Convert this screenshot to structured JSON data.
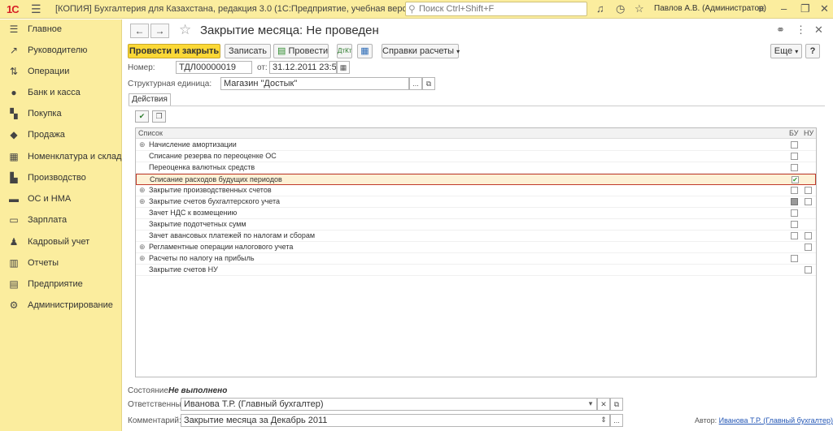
{
  "topbar": {
    "logo": "1С",
    "title": "[КОПИЯ] Бухгалтерия для Казахстана, редакция 3.0  (1С:Предприятие, учебная версия)",
    "search_placeholder": "Поиск Ctrl+Shift+F",
    "user": "Павлов А.В. (Администратор)"
  },
  "sidebar": {
    "items": [
      {
        "icon": "menu-icon",
        "glyph": "☰",
        "label": "Главное"
      },
      {
        "icon": "chart-icon",
        "glyph": "↗",
        "label": "Руководителю"
      },
      {
        "icon": "operations-icon",
        "glyph": "⇅",
        "label": "Операции"
      },
      {
        "icon": "bank-icon",
        "glyph": "●",
        "label": "Банк и касса"
      },
      {
        "icon": "cart-icon",
        "glyph": "▚",
        "label": "Покупка"
      },
      {
        "icon": "sale-icon",
        "glyph": "◆",
        "label": "Продажа"
      },
      {
        "icon": "warehouse-icon",
        "glyph": "▦",
        "label": "Номенклатура и склад"
      },
      {
        "icon": "factory-icon",
        "glyph": "▙",
        "label": "Производство"
      },
      {
        "icon": "truck-icon",
        "glyph": "▬",
        "label": "ОС и НМА"
      },
      {
        "icon": "salary-icon",
        "glyph": "▭",
        "label": "Зарплата"
      },
      {
        "icon": "people-icon",
        "glyph": "♟",
        "label": "Кадровый учет"
      },
      {
        "icon": "reports-icon",
        "glyph": "▥",
        "label": "Отчеты"
      },
      {
        "icon": "building-icon",
        "glyph": "▤",
        "label": "Предприятие"
      },
      {
        "icon": "gear-icon",
        "glyph": "⚙",
        "label": "Администрирование"
      }
    ]
  },
  "document": {
    "title": "Закрытие месяца: Не проведен",
    "toolbar": {
      "post_close": "Провести и закрыть",
      "save": "Записать",
      "post": "Провести",
      "reports": "Справки расчеты",
      "more": "Еще",
      "help": "?"
    },
    "number_label": "Номер:",
    "number_value": "ТДЛ00000019",
    "date_label": "от:",
    "date_value": "31.12.2011 23:59:59",
    "unit_label": "Структурная единица:",
    "unit_value": "Магазин \"Достык\"",
    "tab_label": "Действия",
    "grid": {
      "col_list": "Список",
      "col_bu": "БУ",
      "col_nu": "НУ",
      "rows": [
        {
          "label": "Начисление амортизации",
          "expand": true
        },
        {
          "label": "Списание резерва по переоценке ОС",
          "expand": false
        },
        {
          "label": "Переоценка валютных средств",
          "expand": false
        },
        {
          "label": "Списание расходов будущих периодов",
          "expand": false
        },
        {
          "label": "Закрытие производственных счетов",
          "expand": true
        },
        {
          "label": "Закрытие счетов бухгалтерского учета",
          "expand": true
        },
        {
          "label": "Зачет НДС к возмещению",
          "expand": false
        },
        {
          "label": "Закрытие подотчетных сумм",
          "expand": false
        },
        {
          "label": "Зачет авансовых платежей по налогам и сборам",
          "expand": false
        },
        {
          "label": "Регламентные операции налогового учета",
          "expand": true
        },
        {
          "label": "Расчеты по налогу на прибыль",
          "expand": true
        },
        {
          "label": "Закрытие счетов НУ",
          "expand": false
        }
      ]
    },
    "status_label": "Состояние:",
    "status_value": "Не выполнено",
    "responsible_label": "Ответственный:",
    "responsible_value": "Иванова Т.Р. (Главный бухгалтер)",
    "comment_label": "Комментарий:",
    "comment_value": "Закрытие месяца за Декабрь 2011",
    "author_label": "Автор:",
    "author_value": "Иванова Т.Р. (Главный бухгалтер)"
  }
}
